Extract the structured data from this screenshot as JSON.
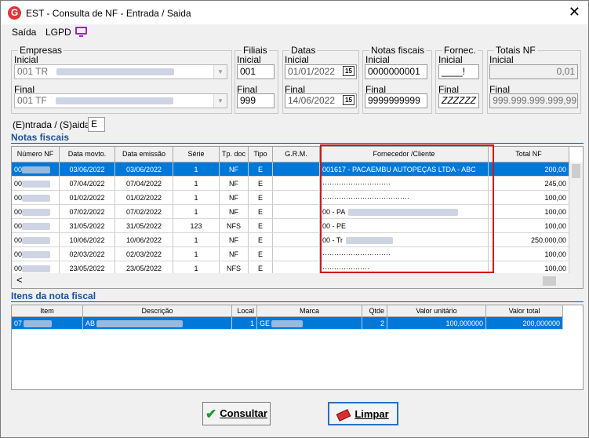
{
  "window": {
    "title": "EST - Consulta de NF - Entrada / Saida",
    "close": "✕",
    "app_icon": "G"
  },
  "menu": [
    "Saída",
    "LGPD"
  ],
  "filters": {
    "empresas": {
      "legend": "Empresas",
      "inicial_label": "Inicial",
      "inicial_value": "001 TR",
      "final_label": "Final",
      "final_value": "001 TF"
    },
    "filiais": {
      "legend": "Filiais",
      "inicial_label": "Inicial",
      "inicial_value": "001",
      "final_label": "Final",
      "final_value": "999"
    },
    "datas": {
      "legend": "Datas",
      "inicial_label": "Inicial",
      "inicial_value": "01/01/2022",
      "final_label": "Final",
      "final_value": "14/06/2022",
      "calendar_glyph": "15"
    },
    "notas": {
      "legend": "Notas fiscais",
      "inicial_label": "Inicial",
      "inicial_value": "0000000001",
      "final_label": "Final",
      "final_value": "9999999999"
    },
    "fornec": {
      "legend": "Fornec.",
      "inicial_label": "Inicial",
      "inicial_value": "____!",
      "final_label": "Final",
      "final_value": "ZZZZZZ"
    },
    "totais": {
      "legend": "Totais NF",
      "inicial_label": "Inicial",
      "inicial_value": "0,01",
      "final_label": "Final",
      "final_value": "999.999.999.999,99"
    },
    "entrada_saida": {
      "label": "(E)ntrada / (S)aida :",
      "value": "E"
    }
  },
  "notas_section": "Notas fiscais",
  "notas_headers": [
    "Número NF",
    "Data movto.",
    "Data emissão",
    "Série",
    "Tp. doc",
    "Tipo",
    "G.R.M.",
    "Fornecedor /Cliente",
    "Total NF"
  ],
  "notas_rows": [
    [
      "00",
      "03/06/2022",
      "03/06/2022",
      "1",
      "NF",
      "E",
      "",
      "001617 - PACAEMBU AUTOPEÇAS LTDA -  ABC",
      "200,00"
    ],
    [
      "00",
      "07/04/2022",
      "07/04/2022",
      "1",
      "NF",
      "E",
      "",
      "·····························",
      "245,00"
    ],
    [
      "00",
      "01/02/2022",
      "01/02/2022",
      "1",
      "NF",
      "E",
      "",
      "·····································",
      "100,00"
    ],
    [
      "00",
      "07/02/2022",
      "07/02/2022",
      "1",
      "NF",
      "E",
      "",
      "00        - PA",
      "100,00"
    ],
    [
      "00",
      "31/05/2022",
      "31/05/2022",
      "123",
      "NFS",
      "E",
      "",
      "00        - PE",
      "100,00"
    ],
    [
      "00",
      "10/06/2022",
      "10/06/2022",
      "1",
      "NF",
      "E",
      "",
      "00        - Tr",
      "250.000,00"
    ],
    [
      "00",
      "02/03/2022",
      "02/03/2022",
      "1",
      "NF",
      "E",
      "",
      "·····························",
      "100,00"
    ],
    [
      "00",
      "23/05/2022",
      "23/05/2022",
      "1",
      "NFS",
      "E",
      "",
      "····················",
      "100,00"
    ]
  ],
  "hscroll_left": "<",
  "itens_section": "Itens da nota fiscal",
  "itens_headers": [
    "Item",
    "Descrição",
    "Local",
    "Marca",
    "Qtde",
    "Valor unitário",
    "Valor total"
  ],
  "itens_rows": [
    [
      "07",
      "AB",
      "1",
      "GE",
      "2",
      "100,000000",
      "200,000000"
    ]
  ],
  "buttons": {
    "consultar": "Consultar",
    "limpar": "Limpar"
  },
  "colors": {
    "accent": "#0078d7",
    "section": "#1b4f99",
    "highlight_box": "#d01717"
  }
}
